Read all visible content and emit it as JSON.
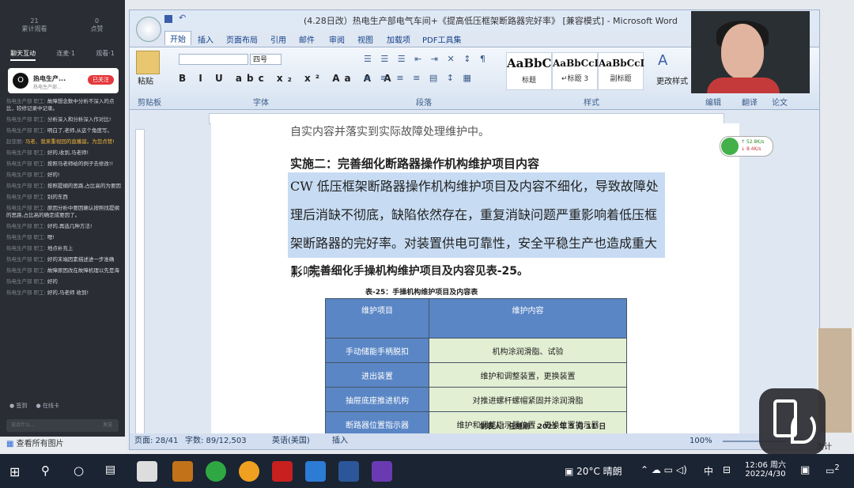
{
  "chat": {
    "stats": [
      {
        "value": "21",
        "label": "累计观看"
      },
      {
        "value": "0",
        "label": "点赞"
      }
    ],
    "tabs": [
      "聊天互动",
      "连麦·1",
      "观看·1"
    ],
    "channel_name": "热电生产...",
    "channel_sub": "热电生产部...",
    "follow_label": "已关注",
    "messages": [
      {
        "user": "热电生产部 职工:",
        "text": "故障想念数中分析不深入的点比，较修记录中记录。"
      },
      {
        "user": "热电生产部 职工:",
        "text": "分析深入和分析深入作对比!"
      },
      {
        "user": "热电生产部 职工:",
        "text": "明白了,老师,从这个角度写。"
      },
      {
        "user": "赵亚丽:",
        "text": "马老、我来重视回的直播留。为您点赞!",
        "hl": true
      },
      {
        "user": "热电生产部 职工:",
        "text": "好的,收到,马老师!"
      },
      {
        "user": "热电生产部 职工:",
        "text": "按照马老师给的例子去修改!!"
      },
      {
        "user": "热电生产部 职工:",
        "text": "好的!"
      },
      {
        "user": "热电生产部 职工:",
        "text": "按照提纲的思路,占比高的为要因"
      },
      {
        "user": "热电生产部 职工:",
        "text": "别的东西"
      },
      {
        "user": "热电生产部 职工:",
        "text": "原因分析中要因确认按照找提纲的思路,占比高的确定成要因了。"
      },
      {
        "user": "热电生产部 职工:",
        "text": "好的,再选几种方法!"
      },
      {
        "user": "热电生产部 职工:",
        "text": "嗯!"
      },
      {
        "user": "热电生产部 职工:",
        "text": "地点补充上"
      },
      {
        "user": "热电生产部 职工:",
        "text": "好的末端因素描述进一步准确"
      },
      {
        "user": "热电生产部 职工:",
        "text": "故障原因改在故障机理以先是海"
      },
      {
        "user": "热电生产部 职工:",
        "text": "好的"
      },
      {
        "user": "热电生产部 职工:",
        "text": "好的,马老师 收到!"
      }
    ],
    "bottom_left": "签到",
    "bottom_right": "在线卡",
    "input_placeholder": "说点什么...",
    "send_label": "发送"
  },
  "photo_bar": {
    "label": "查看所有图片"
  },
  "word": {
    "title": "(4.28日改）热电生产部电气车间+《提高低压框架断路器完好率》 [兼容模式] - Microsoft Word",
    "tabs": [
      "开始",
      "插入",
      "页面布局",
      "引用",
      "邮件",
      "审阅",
      "视图",
      "加载项",
      "PDF工具集"
    ],
    "font_size": "四号",
    "ribbon_groups": [
      "剪贴板",
      "字体",
      "段落",
      "样式",
      "编辑",
      "翻译",
      "论文"
    ],
    "paste_label": "粘贴",
    "styles": [
      {
        "sample": "AaBbC",
        "label": "标题"
      },
      {
        "sample": "AaBbCcD",
        "label": "↵标题 3"
      },
      {
        "sample": "AaBbCcI",
        "label": "副标题"
      }
    ],
    "change_style": "更改样式",
    "page": {
      "cut_line": "自实内容并落实到实际故障处理维护中。",
      "heading": "实施二：完善细化断路器操作机构维护项目内容",
      "paragraph": "CW 低压框架断路器操作机构维护项目及内容不细化，导致故障处理后消缺不彻底，缺陷依然存在，重复消缺问题严重影响着低压框架断路器的完好率。对装置供电可靠性，安全平稳生产也造成重大影响。",
      "subheading": "1、完善细化手操机构维护项目及内容见表-25。",
      "caption": "表-25：手操机构维护项目及内容表",
      "table": {
        "headers": [
          "维护项目",
          "维护内容"
        ],
        "rows": [
          [
            "手动储能手柄脱扣",
            "机构涂润滑脂、试验"
          ],
          [
            "进出装置",
            "维护和调整装置，更换装置"
          ],
          [
            "抽屉底座推进机构",
            "对推进螺杆螺帽紧固并涂润滑脂"
          ],
          [
            "断路器位置指示器",
            "维护和调整指示器位置，更换位置指示器"
          ]
        ]
      },
      "signature": "制表人：任继刚 · 2021 年 5 月 11 日"
    },
    "status": {
      "page": "页面: 28/41",
      "words": "字数: 89/12,503",
      "lang": "英语(美国)",
      "insert": "插入",
      "zoom": "100%"
    }
  },
  "network": {
    "up": "52.8K/s",
    "down": "8.4K/s",
    "percent": "80%"
  },
  "taskbar": {
    "weather": "20°C 晴朗",
    "ime": "中",
    "time": "12:06 周六",
    "date": "2022/4/30",
    "notif": "2",
    "side_text": "次计"
  }
}
